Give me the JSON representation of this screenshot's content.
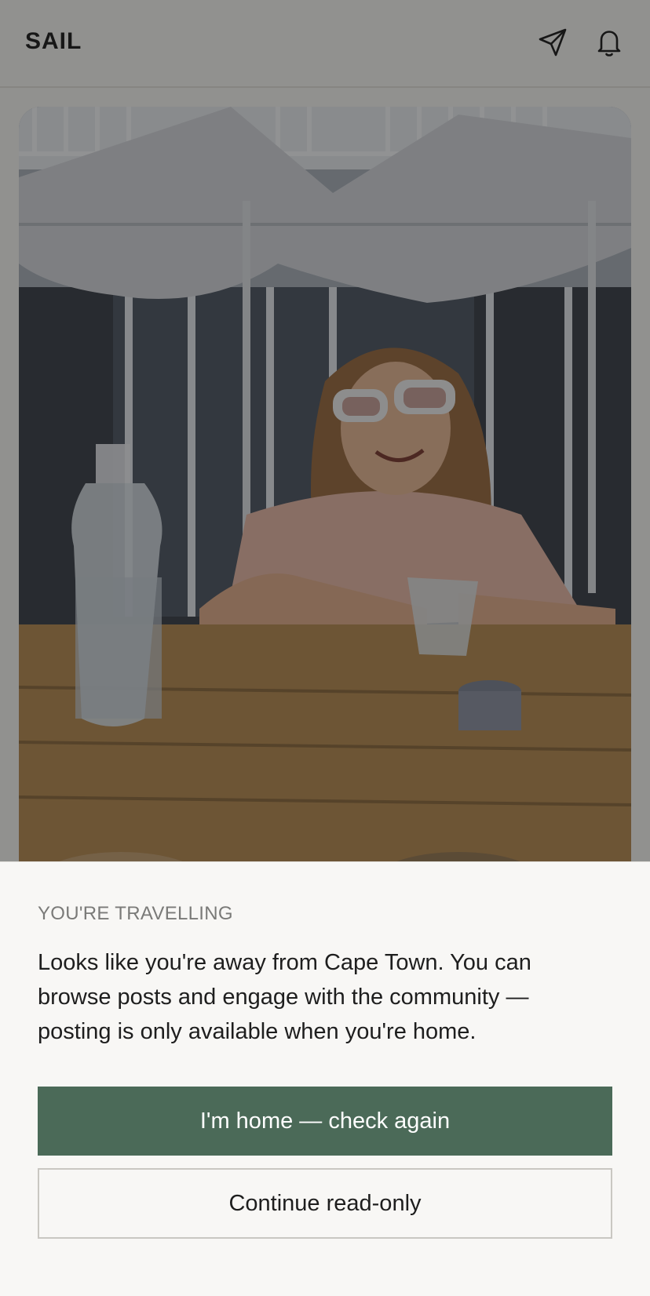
{
  "header": {
    "brand": "SAIL",
    "icons": {
      "send": "paper-plane-icon",
      "notifications": "bell-icon"
    }
  },
  "post": {
    "image_description_icon": "photo"
  },
  "travel_notice": {
    "eyebrow": "YOU'RE TRAVELLING",
    "message": "Looks like you're away from Cape Town. You can browse posts and engage with the community — posting is only available when you're home.",
    "primary_button": "I'm home — check again",
    "secondary_button": "Continue read-only"
  },
  "colors": {
    "accent": "#4b6a58",
    "background": "#f8f7f5",
    "text": "#1e1e1e",
    "muted": "#7a7a78"
  }
}
